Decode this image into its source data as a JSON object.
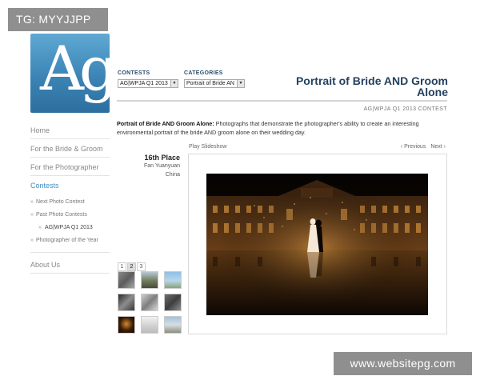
{
  "watermarks": {
    "top": "TG: MYYJJPP",
    "bottom": "www.websitepg.com"
  },
  "logo": {
    "text": "Ag"
  },
  "sidebar": {
    "nav": [
      "Home",
      "For the Bride & Groom",
      "For the Photographer",
      "Contests"
    ],
    "sub": [
      "Next Photo Contest",
      "Past Photo Contests",
      "AG|WPJA Q1 2013",
      "Photographer of the Year"
    ],
    "about": "About Us"
  },
  "filters": {
    "contests_label": "CONTESTS",
    "contests_value": "AG|WPJA Q1 2013",
    "categories_label": "CATEGORIES",
    "categories_value": "Portrait of Bride AN"
  },
  "page": {
    "title": "Portrait of Bride AND Groom Alone",
    "contest": "AG|WPJA Q1 2013 CONTEST",
    "desc_bold": "Portrait of Bride AND Groom Alone:",
    "desc_text": " Photographs that demonstrate the photographer's ability to create an interesting environmental portrait of the bride AND groom alone on their wedding day."
  },
  "entry": {
    "rank": "16th Place",
    "name": "Fan Yuanyuan",
    "country": "China"
  },
  "gallery": {
    "play": "Play Slideshow",
    "prev": "‹ Previous",
    "next": "Next ›",
    "pages": [
      "1",
      "2",
      "3"
    ],
    "current_page": "2"
  },
  "colors": {
    "accent": "#3d8fc4",
    "title": "#24415e",
    "logo_top": "#5fa9d3",
    "logo_bottom": "#2d6f9f"
  }
}
